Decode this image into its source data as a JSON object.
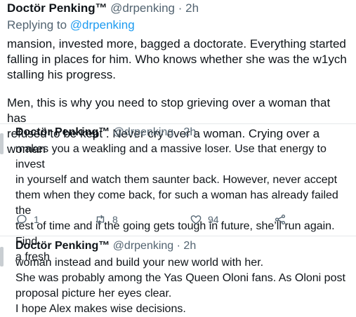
{
  "tweet1": {
    "name": "Doctör Penking™",
    "handle_time": "@drpenking · 2h",
    "replying_prefix": "Replying to",
    "replying_to": "@drpenking",
    "lines": [
      "mansion, invested more, bagged a doctorate. Everything started",
      "falling in places for him. Who knows whether she was the w1ych",
      "stalling his progress.",
      "",
      "Men, this is why you need to stop grieving over a woman that has",
      "refused to be kept . Never cry over a woman. Crying over a woman"
    ]
  },
  "tweet2": {
    "name": "Doctör Penking™",
    "handle_time": "@drpenking · 2h",
    "lines": [
      "makes you a weakling and a massive loser. Use that energy to invest",
      "in yourself and watch them saunter back. However, never accept",
      "them when they come back, for such a woman has already failed the",
      "test of time and if the going gets tough in future, she’ll run again. Find",
      "a fresh"
    ],
    "actions": {
      "reply_count": "1",
      "retweet_count": "8",
      "like_count": "94"
    }
  },
  "tweet3": {
    "name": "Doctör Penking™",
    "handle_time": "@drpenking · 2h",
    "lines": [
      "woman instead and build your new world with her.",
      "She was probably among the Yas Queen Oloni fans. As Oloni post",
      "proposal picture her eyes clear.",
      "I hope Alex makes wise decisions."
    ]
  },
  "colors": {
    "text": "#0f1419",
    "secondary": "#536471",
    "link": "#1d9bf0"
  }
}
